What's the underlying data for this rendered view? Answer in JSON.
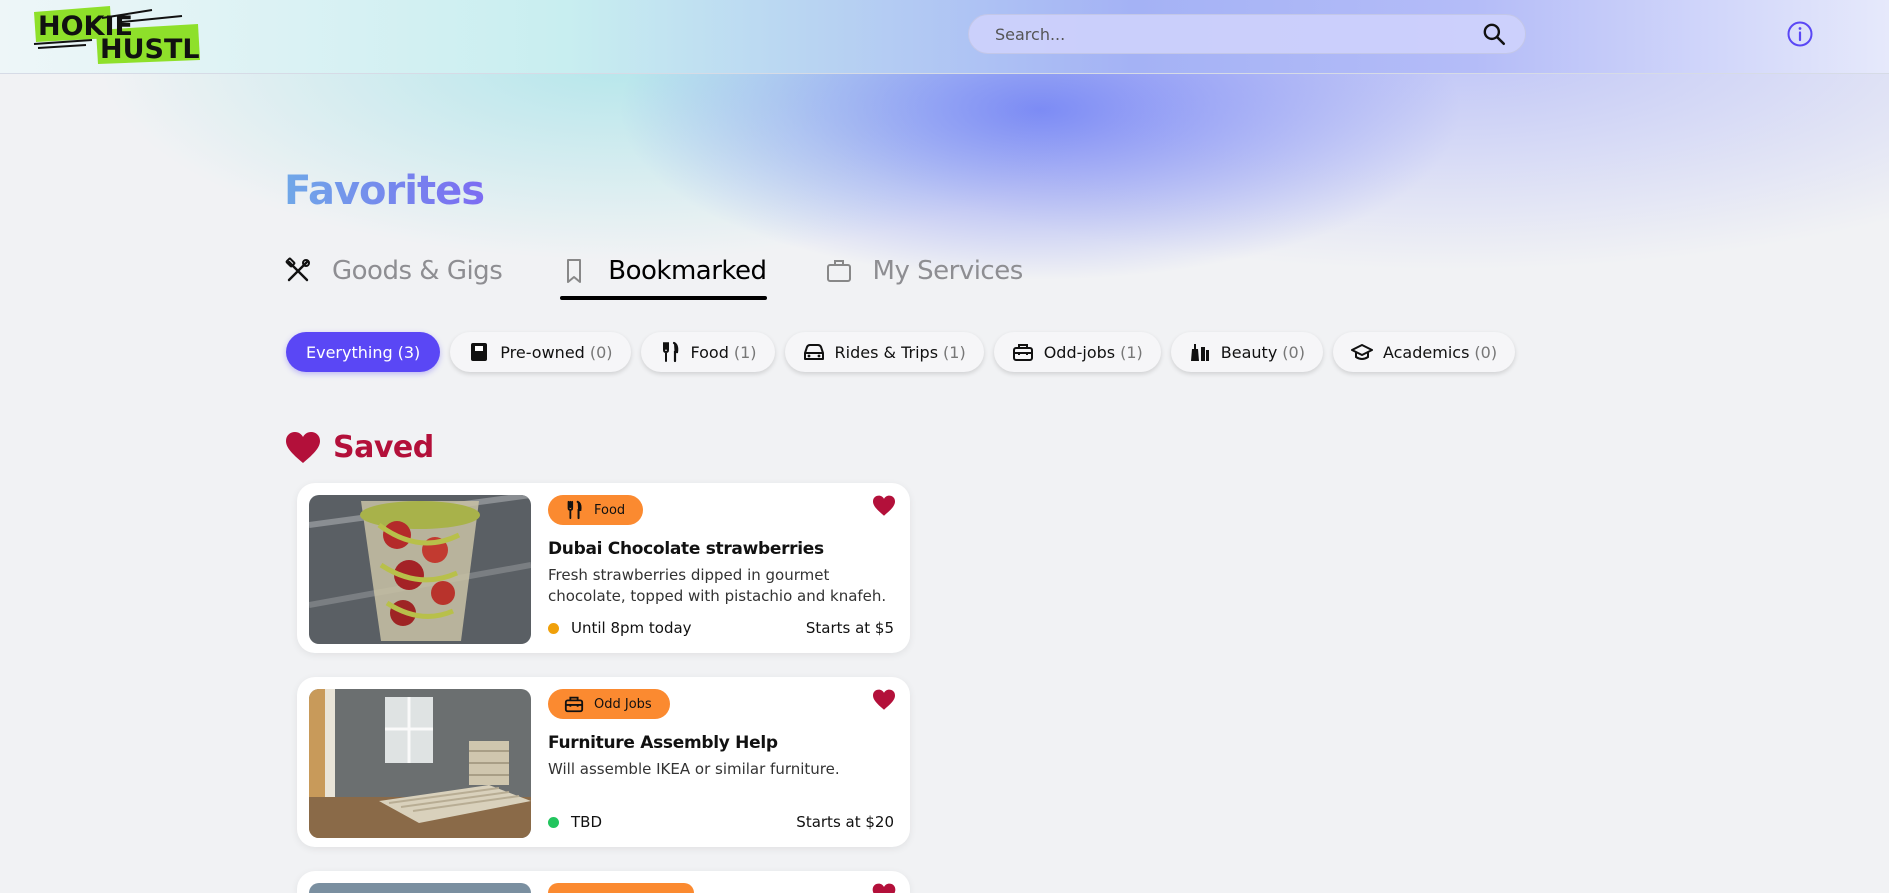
{
  "app": {
    "logo_line1": "HOKIE",
    "logo_line2": "HUSTLE",
    "logo_color": "#8ee02a"
  },
  "header": {
    "search_placeholder": "Search...",
    "search_icon": "search-icon",
    "info_icon": "info-icon",
    "accent": "#5a47f5"
  },
  "page": {
    "title": "Favorites"
  },
  "tabs": [
    {
      "label": "Goods & Gigs",
      "icon": "tools-icon",
      "active": false
    },
    {
      "label": "Bookmarked",
      "icon": "bookmark-icon",
      "active": true
    },
    {
      "label": "My Services",
      "icon": "briefcase-icon",
      "active": false
    }
  ],
  "filters": [
    {
      "label": "Everything",
      "count": "(3)",
      "icon": "",
      "active": true
    },
    {
      "label": "Pre-owned",
      "count": "(0)",
      "icon": "box-icon",
      "active": false
    },
    {
      "label": "Food",
      "count": "(1)",
      "icon": "utensils-icon",
      "active": false
    },
    {
      "label": "Rides & Trips",
      "count": "(1)",
      "icon": "car-icon",
      "active": false
    },
    {
      "label": "Odd-jobs",
      "count": "(1)",
      "icon": "toolbox-icon",
      "active": false
    },
    {
      "label": "Beauty",
      "count": "(0)",
      "icon": "beauty-icon",
      "active": false
    },
    {
      "label": "Academics",
      "count": "(0)",
      "icon": "graduation-cap-icon",
      "active": false
    }
  ],
  "saved": {
    "heading": "Saved",
    "heart_color": "#b3103a"
  },
  "listings": [
    {
      "category": "Food",
      "category_icon": "utensils-icon",
      "title": "Dubai Chocolate strawberries",
      "description": "Fresh strawberries dipped in gourmet chocolate, topped with pistachio and knafeh.",
      "status": "Until 8pm today",
      "status_color": "#f0a00a",
      "price": "Starts at $5",
      "image": "strawberry-cup-photo"
    },
    {
      "category": "Odd Jobs",
      "category_icon": "toolbox-icon",
      "title": "Furniture Assembly Help",
      "description": "Will assemble IKEA or similar furniture.",
      "status": "TBD",
      "status_color": "#22c55e",
      "price": "Starts at $20",
      "image": "bed-frame-photo"
    }
  ]
}
